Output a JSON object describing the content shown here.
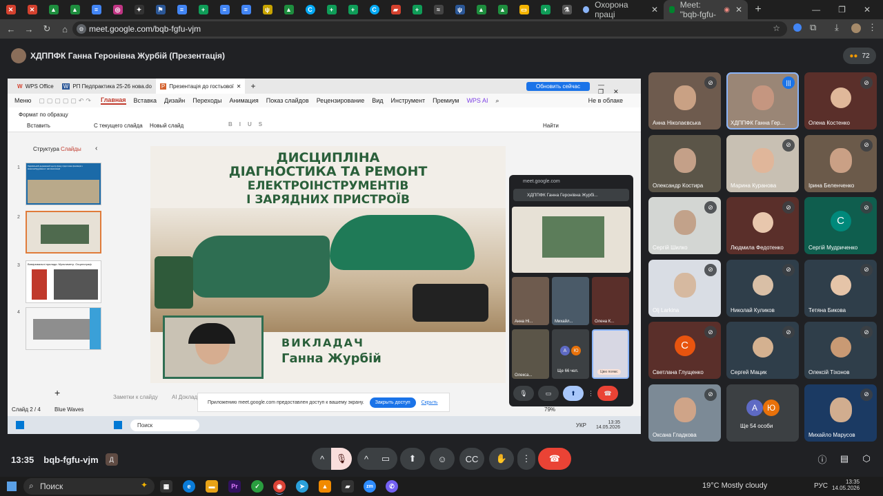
{
  "browser": {
    "tabs": [
      {
        "label": "Охорона праці"
      },
      {
        "label": "Meet: \"bqb-fgfu-"
      }
    ],
    "url": "meet.google.com/bqb-fgfu-vjm"
  },
  "meet": {
    "presenter_title": "ХДППФК Ганна Геронівна Журбій (Презентація)",
    "participant_count": "72",
    "meeting_code": "bqb-fgfu-vjm",
    "time": "13:35"
  },
  "wps": {
    "tabs": [
      {
        "label": "WPS Office"
      },
      {
        "label": "РП Педпрактика 25-26 нова.do"
      },
      {
        "label": "Презентація до гостьової"
      }
    ],
    "update_button": "Обновить сейчас",
    "menu": [
      "Меню",
      "Главная",
      "Вставка",
      "Дизайн",
      "Переходы",
      "Анимация",
      "Показ слайдов",
      "Рецензирование",
      "Вид",
      "Инструмент",
      "Премиум",
      "WPS AI"
    ],
    "cloud_status": "Не в облаке",
    "tools": {
      "format_painter": "Формат по образцу",
      "paste": "Вставить",
      "from_current": "С текущего слайда",
      "new_slide": "Новый слайд",
      "find": "Найти"
    },
    "panel_tabs": [
      "Структура",
      "Слайды"
    ],
    "thumb1_text": "Харківський державний центр фаху підготовки фахівців з машинобудування і автоматизації",
    "thumb3_text": "Вимірювальні прилади. Мультиметр. Осцилограф",
    "notes": "Заметки к слайду",
    "ai_report": "AI Доклад",
    "status_slide": "Слайд 2 / 4",
    "theme": "Blue Waves",
    "zoom": "79%"
  },
  "slide": {
    "title_lines": [
      "ДИСЦИПЛІНА",
      "ДІАГНОСТИКА ТА РЕМОНТ",
      "ЕЛЕКТРОІНСТРУМЕНТІВ",
      "І ЗАРЯДНИХ ПРИСТРОЇВ"
    ],
    "teacher_role": "ВИКЛАДАЧ",
    "teacher_name": "Ганна Журбій"
  },
  "mini_meet": {
    "url": "meet.google.com",
    "presenter": "ХДППФК Ганна Геронівна Журбі...",
    "tiles": [
      {
        "label": "Анна Ні..."
      },
      {
        "label": "Михайл..."
      },
      {
        "label": "Олена К..."
      },
      {
        "label": "Олекса..."
      },
      {
        "label": "Ще 66 чел."
      },
      {
        "label": "Цвю поямс"
      }
    ],
    "avatars": [
      "A",
      "Ю"
    ]
  },
  "share_notice": {
    "text": "Приложению meet.google.com предоставлен доступ к вашему экрану.",
    "stop_label": "Закрыть доступ",
    "hide_label": "Скрыть"
  },
  "inner_taskbar": {
    "search": "Поиск",
    "lang": "УКР",
    "time": "13:35",
    "date": "14.05.2026"
  },
  "participants": [
    {
      "name": "Анна Ніколаєвська",
      "kind": "video",
      "bg": "#6e5b4e",
      "face": "#c9a184",
      "muted": true
    },
    {
      "name": "ХДППФК Ганна Гер...",
      "kind": "video",
      "bg": "#9a8676",
      "face": "#c59680",
      "speaking": true
    },
    {
      "name": "Олена Костенко",
      "kind": "photo",
      "bg": "#5a2f2a",
      "face": "#e0b89a",
      "muted": true
    },
    {
      "name": "Олександр Костира",
      "kind": "video",
      "bg": "#5b5548",
      "face": "#c4a088",
      "muted": false
    },
    {
      "name": "Марина Куранова",
      "kind": "video",
      "bg": "#c8c0b3",
      "face": "#e0b69a",
      "muted": true
    },
    {
      "name": "Ірина Беленченко",
      "kind": "video",
      "bg": "#6b5a4a",
      "face": "#caa085",
      "muted": true
    },
    {
      "name": "Сергій Шилко",
      "kind": "video",
      "bg": "#d3d6d3",
      "face": "#c2a28a",
      "muted": true
    },
    {
      "name": "Людмила Федотенко",
      "kind": "photo",
      "bg": "#5a2f2a",
      "face": "#e8c7ad",
      "muted": true
    },
    {
      "name": "Сергій Мудриченко",
      "kind": "initial",
      "bg": "#0f5e4e",
      "initial": "С",
      "initial_bg": "#00897b",
      "muted": true
    },
    {
      "name": "Olj Larkina",
      "kind": "video",
      "bg": "#d9dde4",
      "face": "#d6b9a0",
      "muted": true
    },
    {
      "name": "Николай Куликов",
      "kind": "photo",
      "bg": "#2f3e4a",
      "face": "#d9bfa6",
      "muted": true
    },
    {
      "name": "Тетяна Бикова",
      "kind": "photo",
      "bg": "#2f3e4a",
      "face": "#e5c4a8",
      "muted": true
    },
    {
      "name": "Светлана Глущенко",
      "kind": "initial",
      "bg": "#5a2f2a",
      "initial": "С",
      "initial_bg": "#e8540f",
      "muted": true
    },
    {
      "name": "Сергей Мацик",
      "kind": "photo",
      "bg": "#2f3e4a",
      "face": "#d4b190",
      "muted": true
    },
    {
      "name": "Олексій Тіхонов",
      "kind": "photo",
      "bg": "#2f3e4a",
      "face": "#c99a74",
      "muted": true
    },
    {
      "name": "Оксана Гладкова",
      "kind": "video",
      "bg": "#7c8a96",
      "face": "#cfa488",
      "muted": true
    },
    {
      "name": "Ще 54 особи",
      "kind": "more",
      "bg": "#3c4043",
      "avatars": [
        "A",
        "Ю"
      ]
    },
    {
      "name": "Михайло Марусов",
      "kind": "video",
      "bg": "#1b3a63",
      "face": "#d1ad8f",
      "muted": true
    }
  ],
  "os": {
    "search": "Поиск",
    "weather": "19°C  Mostly cloudy",
    "lang": "РУС",
    "time": "13:35",
    "date": "14.05.2026"
  }
}
